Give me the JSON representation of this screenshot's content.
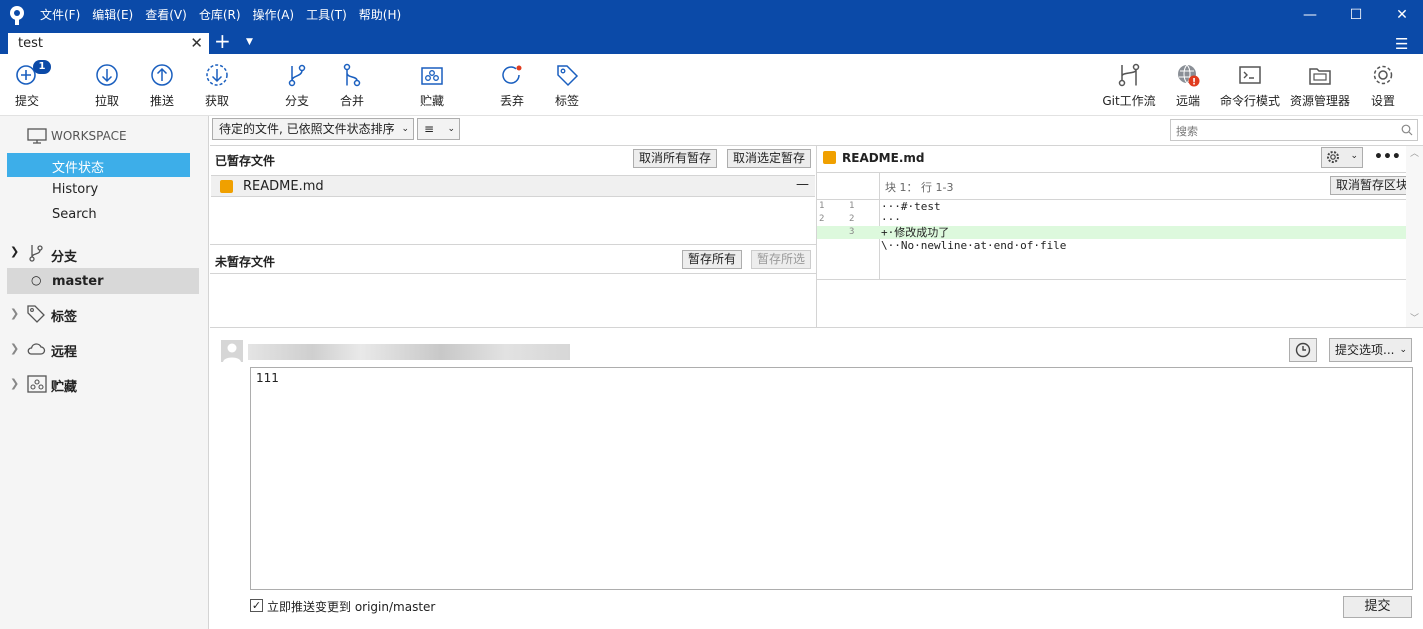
{
  "menu": [
    "文件(F)",
    "编辑(E)",
    "查看(V)",
    "仓库(R)",
    "操作(A)",
    "工具(T)",
    "帮助(H)"
  ],
  "tab": {
    "title": "test"
  },
  "toolbar": {
    "commit": "提交",
    "commit_badge": "1",
    "pull": "拉取",
    "push": "推送",
    "fetch": "获取",
    "branch": "分支",
    "merge": "合并",
    "stash": "贮藏",
    "discard": "丢弃",
    "tag": "标签",
    "gitflow": "Git工作流",
    "remote": "远端",
    "terminal": "命令行模式",
    "explorer": "资源管理器",
    "settings": "设置"
  },
  "sidebar": {
    "workspace": "WORKSPACE",
    "file_status": "文件状态",
    "history": "History",
    "search": "Search",
    "branches": "分支",
    "branch_master": "master",
    "tags": "标签",
    "remotes": "远程",
    "stashes": "贮藏"
  },
  "filters": {
    "sort": "待定的文件, 已依照文件状态排序",
    "view": "≡",
    "search_placeholder": "搜索"
  },
  "staged": {
    "title": "已暂存文件",
    "unstage_all": "取消所有暂存",
    "unstage_selected": "取消选定暂存",
    "files": [
      "README.md"
    ]
  },
  "unstaged": {
    "title": "未暂存文件",
    "stage_all": "暂存所有",
    "stage_selected": "暂存所选"
  },
  "diff": {
    "file": "README.md",
    "hunk_header": "块 1： 行 1-3",
    "unstage_hunk": "取消暂存区块",
    "lines": [
      {
        "old": "1",
        "new": "1",
        "text": "···#·test",
        "type": "ctx"
      },
      {
        "old": "2",
        "new": "2",
        "text": "···",
        "type": "ctx"
      },
      {
        "old": "",
        "new": "3",
        "text": "+·修改成功了",
        "type": "add"
      },
      {
        "old": "",
        "new": "",
        "text": "\\··No·newline·at·end·of·file",
        "type": "ctx"
      }
    ]
  },
  "commit": {
    "message": "111",
    "options": "提交选项...",
    "push_checkbox": "立即推送变更到 origin/master",
    "submit": "提交"
  },
  "colors": {
    "titlebar": "#0b4aa8",
    "selection": "#3daee9",
    "added_line": "#ddf9dd"
  }
}
